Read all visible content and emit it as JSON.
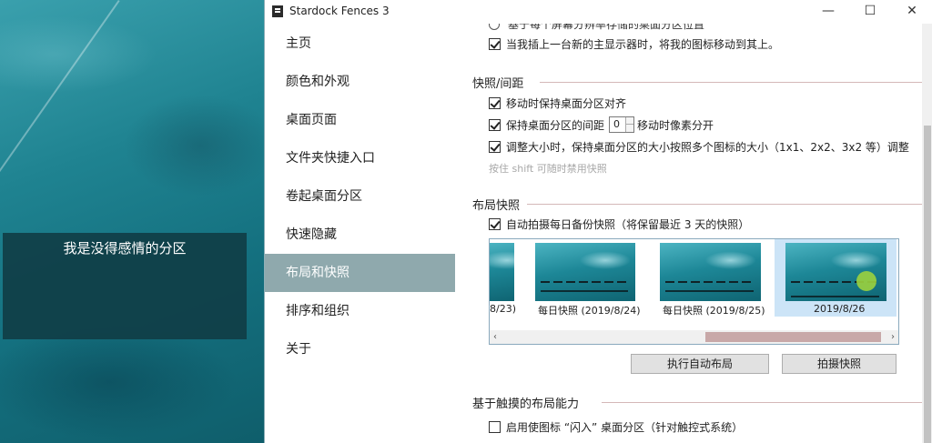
{
  "desktop": {
    "fence_title": "我是没得感情的分区"
  },
  "window": {
    "title": "Stardock Fences 3",
    "minimize_glyph": "—",
    "maximize_glyph": "☐",
    "close_glyph": "✕"
  },
  "sidebar": {
    "items": [
      {
        "label": "主页"
      },
      {
        "label": "颜色和外观"
      },
      {
        "label": "桌面页面"
      },
      {
        "label": "文件夹快捷入口"
      },
      {
        "label": "卷起桌面分区"
      },
      {
        "label": "快速隐藏"
      },
      {
        "label": "布局和快照"
      },
      {
        "label": "排序和组织"
      },
      {
        "label": "关于"
      }
    ],
    "active_label": "布局和快照"
  },
  "content": {
    "top_cut_text": "基于每个屏幕分辨率存储的桌面分区位置",
    "move_to_primary": "当我插上一台新的主显示器时，将我的图标移动到其上。",
    "snap": {
      "title": "快照/间距",
      "keep_aligned": "移动时保持桌面分区对齐",
      "keep_spacing_pre": "保持桌面分区的间距",
      "spacing_value": "0",
      "keep_spacing_post": "移动时像素分开",
      "resize_snap": "调整大小时，保持桌面分区的大小按照多个图标的大小（1x1、2x2、3x2 等）调整",
      "hint": "按住 shift 可随时禁用快照"
    },
    "layout_snapshots": {
      "title": "布局快照",
      "auto_daily": "自动拍摄每日备份快照（将保留最近 3 天的快照）",
      "snapshots": [
        {
          "label": "8/23)"
        },
        {
          "label": "每日快照 (2019/8/24)"
        },
        {
          "label": "每日快照 (2019/8/25)"
        },
        {
          "label": "2019/8/26"
        }
      ],
      "scroll_left": "‹",
      "scroll_right": "›",
      "auto_layout_button": "执行自动布局",
      "take_snapshot_button": "拍摄快照"
    },
    "touch": {
      "title": "基于触摸的布局能力",
      "enable_flick": "启用使图标 “闪入” 桌面分区（针对触控式系统）"
    }
  },
  "colors": {
    "sidebar_active_bg": "#8fa9ad",
    "section_line": "#d4b8b8",
    "selection_bg": "#cce4f7"
  }
}
